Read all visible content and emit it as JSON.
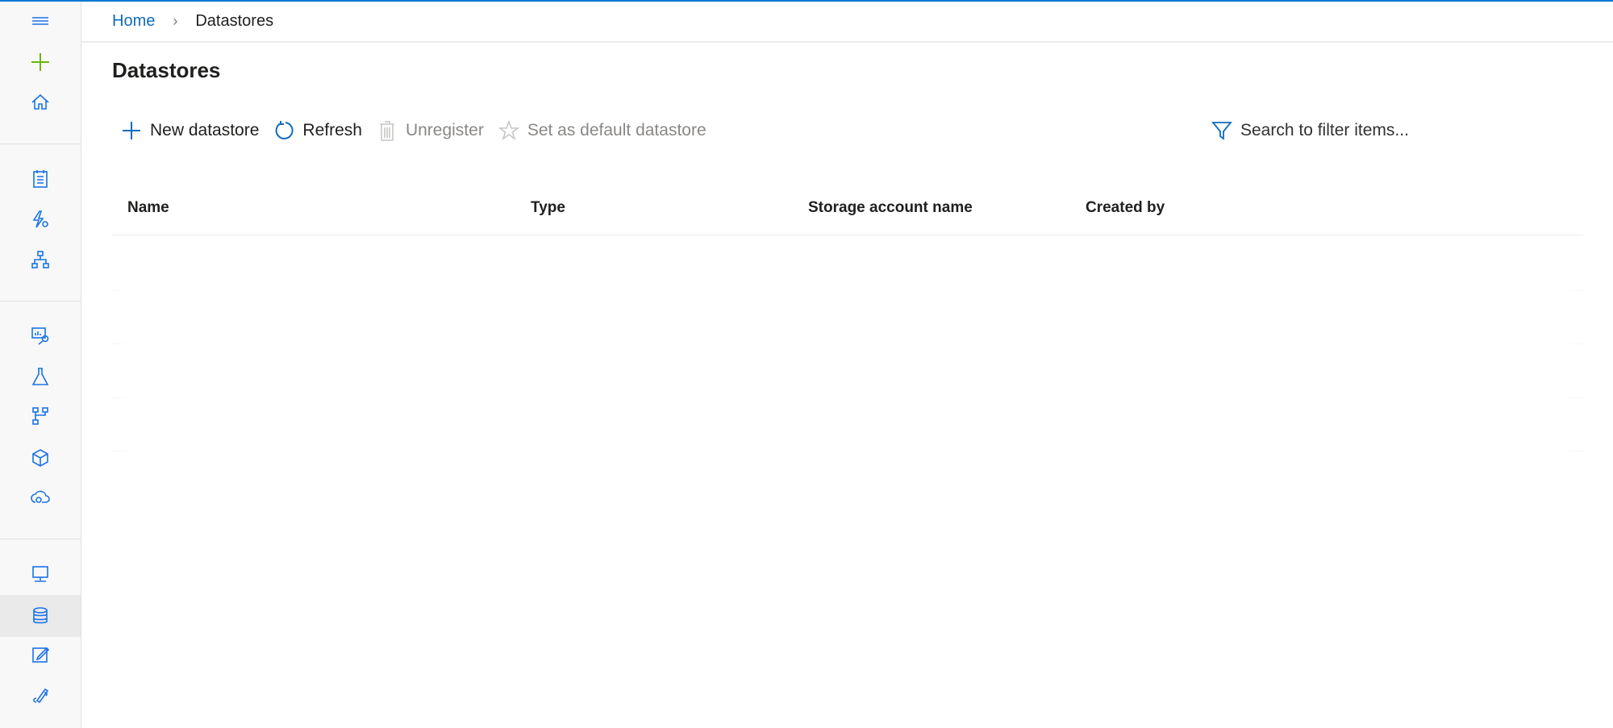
{
  "breadcrumb": {
    "home": "Home",
    "separator": "›",
    "current": "Datastores"
  },
  "page_title": "Datastores",
  "toolbar": {
    "new_datastore": "New datastore",
    "refresh": "Refresh",
    "unregister": "Unregister",
    "set_default": "Set as default datastore"
  },
  "search": {
    "placeholder": "Search to filter items..."
  },
  "table": {
    "columns": [
      "Name",
      "Type",
      "Storage account name",
      "Created by"
    ]
  },
  "sidebar": {
    "items": [
      "menu-icon",
      "create-new-icon",
      "home-icon",
      "notebooks-icon",
      "automated-ml-icon",
      "designer-icon",
      "datasets-icon",
      "experiments-icon",
      "pipelines-icon",
      "models-icon",
      "endpoints-icon",
      "compute-icon",
      "datastores-icon",
      "data-labeling-icon",
      "linked-services-icon"
    ],
    "selected": "datastores-icon"
  },
  "colors": {
    "accent": "#0078d4",
    "add": "#6bb700"
  }
}
